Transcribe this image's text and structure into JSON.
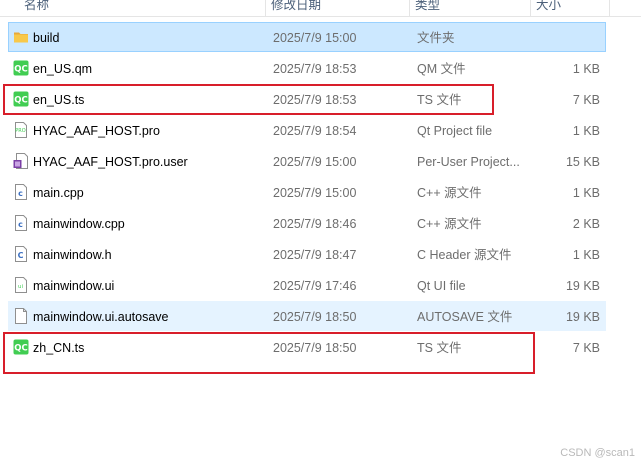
{
  "columns": {
    "name": "名称",
    "date": "修改日期",
    "type": "类型",
    "size": "大小"
  },
  "files": [
    {
      "name": "build",
      "date": "2025/7/9 15:00",
      "type": "文件夹",
      "size": "",
      "icon": "folder-icon"
    },
    {
      "name": "en_US.qm",
      "date": "2025/7/9 18:53",
      "type": "QM 文件",
      "size": "1 KB",
      "icon": "qt-linguist-icon"
    },
    {
      "name": "en_US.ts",
      "date": "2025/7/9 18:53",
      "type": "TS 文件",
      "size": "7 KB",
      "icon": "qt-linguist-icon"
    },
    {
      "name": "HYAC_AAF_HOST.pro",
      "date": "2025/7/9 18:54",
      "type": "Qt Project file",
      "size": "1 KB",
      "icon": "qt-project-file-icon"
    },
    {
      "name": "HYAC_AAF_HOST.pro.user",
      "date": "2025/7/9 15:00",
      "type": "Per-User Project...",
      "size": "15 KB",
      "icon": "user-project-file-icon"
    },
    {
      "name": "main.cpp",
      "date": "2025/7/9 15:00",
      "type": "C++ 源文件",
      "size": "1 KB",
      "icon": "cpp-source-file-icon"
    },
    {
      "name": "mainwindow.cpp",
      "date": "2025/7/9 18:46",
      "type": "C++ 源文件",
      "size": "2 KB",
      "icon": "cpp-source-file-icon"
    },
    {
      "name": "mainwindow.h",
      "date": "2025/7/9 18:47",
      "type": "C Header 源文件",
      "size": "1 KB",
      "icon": "c-header-file-icon"
    },
    {
      "name": "mainwindow.ui",
      "date": "2025/7/9 17:46",
      "type": "Qt UI file",
      "size": "19 KB",
      "icon": "qt-ui-file-icon"
    },
    {
      "name": "mainwindow.ui.autosave",
      "date": "2025/7/9 18:50",
      "type": "AUTOSAVE 文件",
      "size": "19 KB",
      "icon": "generic-file-icon"
    },
    {
      "name": "zh_CN.ts",
      "date": "2025/7/9 18:50",
      "type": "TS 文件",
      "size": "7 KB",
      "icon": "qt-linguist-icon"
    }
  ],
  "selected_item": "build",
  "hovered_item": "mainwindow.ui.autosave",
  "highlighted_items": [
    "en_US.ts",
    "zh_CN.ts"
  ],
  "colors": {
    "annotation": "#d81e2a",
    "selection": "#cce8ff",
    "hover": "#e5f3ff",
    "qt_green": "#41cd52",
    "folder": "#f8c84a"
  },
  "watermark": "CSDN @scan1"
}
